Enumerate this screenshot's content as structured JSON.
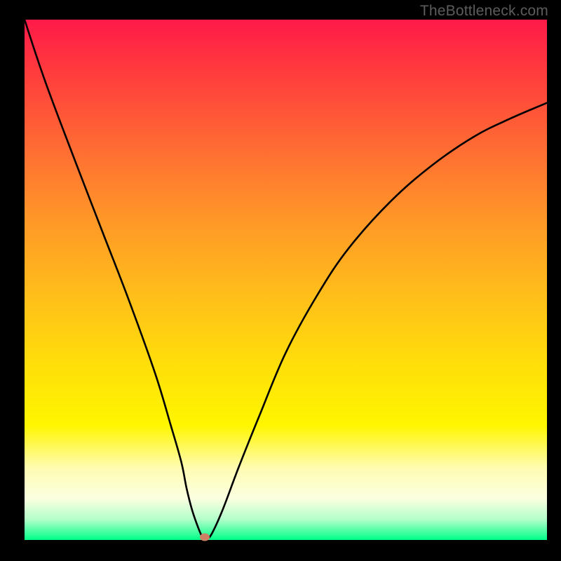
{
  "watermark": "TheBottleneck.com",
  "chart_data": {
    "type": "line",
    "title": "",
    "xlabel": "",
    "ylabel": "",
    "xlim": [
      0,
      100
    ],
    "ylim": [
      0,
      100
    ],
    "series": [
      {
        "name": "curve",
        "x": [
          0,
          4,
          10,
          15,
          20,
          25,
          28,
          30,
          31,
          32,
          33,
          33.8,
          34.3,
          35,
          36,
          38,
          41,
          45,
          50,
          56,
          62,
          70,
          78,
          86,
          93,
          100
        ],
        "values": [
          100,
          88,
          72,
          59,
          46,
          32,
          22,
          15,
          10,
          6,
          3,
          1.0,
          0.2,
          0.2,
          1.5,
          6,
          14,
          24,
          36,
          47,
          56,
          65,
          72,
          77.5,
          81,
          84
        ]
      }
    ],
    "marker": {
      "x": 34.5,
      "y": 0.6
    },
    "gradient_stops": [
      {
        "pct": 0,
        "color": "#ff1a49"
      },
      {
        "pct": 25,
        "color": "#ff8a2e"
      },
      {
        "pct": 55,
        "color": "#ffd712"
      },
      {
        "pct": 78,
        "color": "#fff600"
      },
      {
        "pct": 92,
        "color": "#fbffe0"
      },
      {
        "pct": 100,
        "color": "#00ff87"
      }
    ]
  }
}
